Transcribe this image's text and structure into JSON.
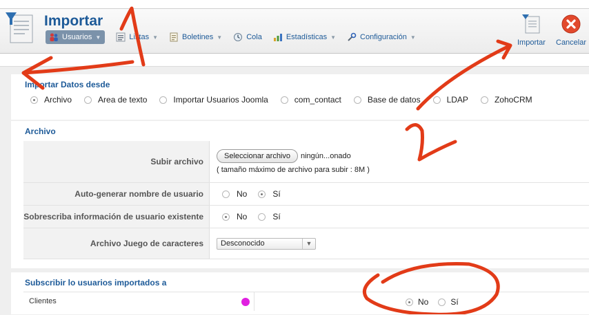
{
  "header": {
    "title": "Importar",
    "nav": [
      {
        "label": "Usuarios",
        "icon": "users-icon",
        "active": true,
        "has_caret": true
      },
      {
        "label": "Listas",
        "icon": "lists-icon",
        "active": false,
        "has_caret": true
      },
      {
        "label": "Boletines",
        "icon": "newsletter-icon",
        "active": false,
        "has_caret": true
      },
      {
        "label": "Cola",
        "icon": "queue-icon",
        "active": false,
        "has_caret": false
      },
      {
        "label": "Estadísticas",
        "icon": "statistics-icon",
        "active": false,
        "has_caret": true
      },
      {
        "label": "Configuración",
        "icon": "configuration-icon",
        "active": false,
        "has_caret": true
      }
    ],
    "actions": {
      "import_label": "Importar",
      "cancel_label": "Cancelar"
    }
  },
  "import_from": {
    "title": "Importar Datos desde",
    "options": [
      "Archivo",
      "Area de texto",
      "Importar Usuarios Joomla",
      "com_contact",
      "Base de datos",
      "LDAP",
      "ZohoCRM"
    ],
    "selected": "Archivo"
  },
  "file_section": {
    "title": "Archivo",
    "upload": {
      "label": "Subir archivo",
      "button_label": "Seleccionar archivo",
      "no_file_text": "ningún...onado",
      "max_size_text": "( tamaño máximo de archivo para subir : 8M )"
    },
    "autogen": {
      "label": "Auto-generar nombre de usuario",
      "no": "No",
      "yes": "Sí",
      "selected": "Sí"
    },
    "overwrite": {
      "label": "Sobrescriba información de usuario existente",
      "no": "No",
      "yes": "Sí",
      "selected": "No"
    },
    "charset": {
      "label": "Archivo Juego de caracteres",
      "value": "Desconocido"
    }
  },
  "subscribe_section": {
    "title": "Subscribir lo usuarios importados a",
    "rows": [
      {
        "list": "Clientes",
        "color": "#e020e0",
        "no": "No",
        "yes": "Sí",
        "selected": "No"
      }
    ]
  },
  "colors": {
    "accent": "#1d5a98",
    "annotation": "#e23b18",
    "active_nav": "#7b92aa"
  }
}
